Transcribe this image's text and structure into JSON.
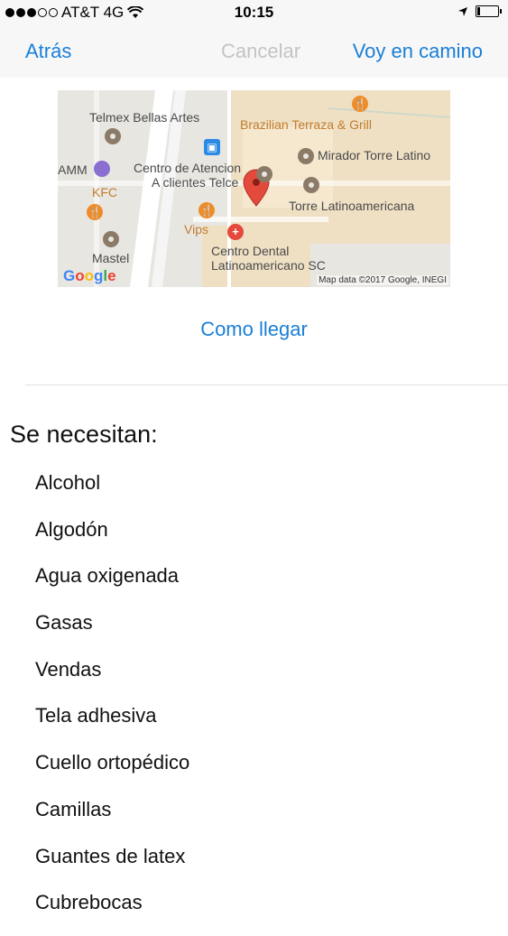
{
  "status_bar": {
    "carrier": "AT&T 4G",
    "time": "10:15",
    "signal_icon": "signal-dots-icon",
    "wifi_icon": "wifi-icon",
    "location_icon": "location-arrow-icon",
    "battery_icon": "battery-icon"
  },
  "nav": {
    "back_label": "Atrás",
    "cancel_label": "Cancelar",
    "on_my_way_label": "Voy en camino"
  },
  "map": {
    "labels": {
      "telmex": "Telmex Bellas Artes",
      "brazilian": "Brazilian Terraza & Grill",
      "mirador": "Mirador Torre Latino",
      "amm": "AMM",
      "centro_atencion_1": "Centro de Atencion",
      "centro_atencion_2": "A clientes Telce",
      "kfc": "KFC",
      "torre": "Torre Latinoamericana",
      "vips": "Vips",
      "centro_dental_1": "Centro Dental",
      "centro_dental_2": "Latinoamericano SC",
      "mastel": "Mastel"
    },
    "google_logo": "Google",
    "attribution": "Map data ©2017 Google, INEGI",
    "colors": {
      "background": "#e8e6e1",
      "block": "#efe0c4",
      "road": "#ffffff",
      "pin": "#e34a3b"
    }
  },
  "directions_label": "Como llegar",
  "needs": {
    "title": "Se necesitan:",
    "items": [
      "Alcohol",
      "Algodón",
      "Agua oxigenada",
      "Gasas",
      "Vendas",
      "Tela adhesiva",
      "Cuello ortopédico",
      "Camillas",
      "Guantes de latex",
      "Cubrebocas"
    ]
  },
  "colors": {
    "accent": "#1a7fd6",
    "disabled": "#c4c4c4",
    "bar_background": "#f7f7f7"
  }
}
